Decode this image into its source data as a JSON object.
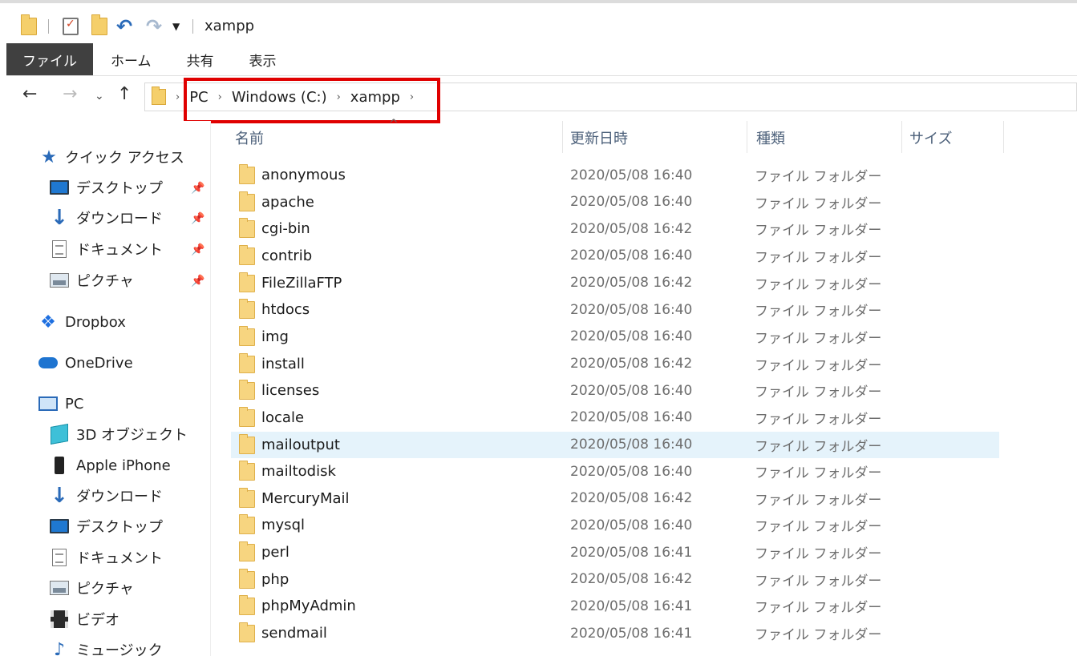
{
  "window": {
    "title": "xampp"
  },
  "ribbon": {
    "tabs": [
      "ファイル",
      "ホーム",
      "共有",
      "表示"
    ]
  },
  "address": {
    "crumbs": [
      "PC",
      "Windows (C:)",
      "xampp"
    ]
  },
  "sidebar": {
    "quick_access": "クイック アクセス",
    "quick_items": [
      "デスクトップ",
      "ダウンロード",
      "ドキュメント",
      "ピクチャ"
    ],
    "dropbox": "Dropbox",
    "onedrive": "OneDrive",
    "pc": "PC",
    "pc_items": [
      "3D オブジェクト",
      "Apple iPhone",
      "ダウンロード",
      "デスクトップ",
      "ドキュメント",
      "ピクチャ",
      "ビデオ",
      "ミュージック"
    ]
  },
  "columns": {
    "name": "名前",
    "date": "更新日時",
    "type": "種類",
    "size": "サイズ"
  },
  "files": [
    {
      "name": "anonymous",
      "date": "2020/05/08 16:40",
      "type": "ファイル フォルダー"
    },
    {
      "name": "apache",
      "date": "2020/05/08 16:40",
      "type": "ファイル フォルダー"
    },
    {
      "name": "cgi-bin",
      "date": "2020/05/08 16:42",
      "type": "ファイル フォルダー"
    },
    {
      "name": "contrib",
      "date": "2020/05/08 16:40",
      "type": "ファイル フォルダー"
    },
    {
      "name": "FileZillaFTP",
      "date": "2020/05/08 16:42",
      "type": "ファイル フォルダー"
    },
    {
      "name": "htdocs",
      "date": "2020/05/08 16:40",
      "type": "ファイル フォルダー"
    },
    {
      "name": "img",
      "date": "2020/05/08 16:40",
      "type": "ファイル フォルダー"
    },
    {
      "name": "install",
      "date": "2020/05/08 16:42",
      "type": "ファイル フォルダー"
    },
    {
      "name": "licenses",
      "date": "2020/05/08 16:40",
      "type": "ファイル フォルダー"
    },
    {
      "name": "locale",
      "date": "2020/05/08 16:40",
      "type": "ファイル フォルダー"
    },
    {
      "name": "mailoutput",
      "date": "2020/05/08 16:40",
      "type": "ファイル フォルダー"
    },
    {
      "name": "mailtodisk",
      "date": "2020/05/08 16:40",
      "type": "ファイル フォルダー"
    },
    {
      "name": "MercuryMail",
      "date": "2020/05/08 16:42",
      "type": "ファイル フォルダー"
    },
    {
      "name": "mysql",
      "date": "2020/05/08 16:40",
      "type": "ファイル フォルダー"
    },
    {
      "name": "perl",
      "date": "2020/05/08 16:41",
      "type": "ファイル フォルダー"
    },
    {
      "name": "php",
      "date": "2020/05/08 16:42",
      "type": "ファイル フォルダー"
    },
    {
      "name": "phpMyAdmin",
      "date": "2020/05/08 16:41",
      "type": "ファイル フォルダー"
    },
    {
      "name": "sendmail",
      "date": "2020/05/08 16:41",
      "type": "ファイル フォルダー"
    }
  ],
  "hovered_file": "mailoutput",
  "colors": {
    "highlight_box": "#e00000",
    "hover_row": "#e5f3fb",
    "file_tab": "#404040",
    "folder": "#f7d580"
  }
}
